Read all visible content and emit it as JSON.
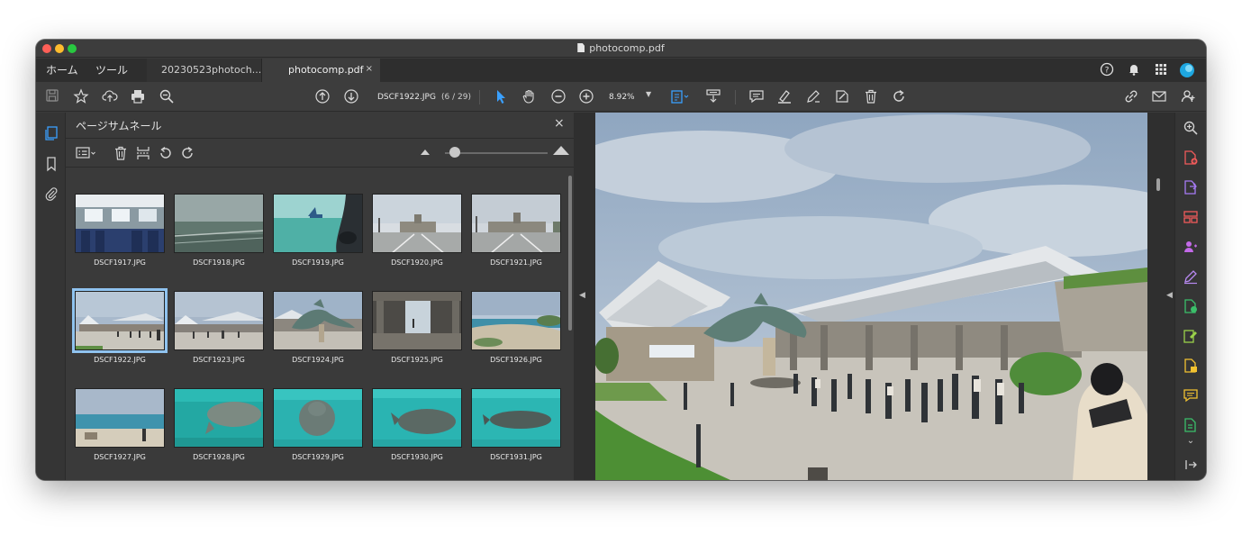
{
  "window": {
    "title": "photocomp.pdf"
  },
  "tabs": {
    "home": "ホーム",
    "tools": "ツール",
    "documents": [
      {
        "label": "20230523photoch..."
      },
      {
        "label": "photocomp.pdf",
        "close": "×"
      }
    ]
  },
  "toolbar": {
    "filename": "DSCF1922.JPG",
    "page_count": "(6 / 29)",
    "zoom": "8.92%"
  },
  "panel": {
    "title": "ページサムネール",
    "close": "×",
    "thumbnail_slider_value": 0.1,
    "thumbnails": [
      {
        "label": "DSCF1917.JPG"
      },
      {
        "label": "DSCF1918.JPG"
      },
      {
        "label": "DSCF1919.JPG"
      },
      {
        "label": "DSCF1920.JPG"
      },
      {
        "label": "DSCF1921.JPG"
      },
      {
        "label": "DSCF1922.JPG"
      },
      {
        "label": "DSCF1923.JPG"
      },
      {
        "label": "DSCF1924.JPG"
      },
      {
        "label": "DSCF1925.JPG"
      },
      {
        "label": "DSCF1926.JPG"
      },
      {
        "label": "DSCF1927.JPG"
      },
      {
        "label": "DSCF1928.JPG"
      },
      {
        "label": "DSCF1929.JPG"
      },
      {
        "label": "DSCF1930.JPG"
      },
      {
        "label": "DSCF1931.JPG"
      }
    ]
  },
  "colors": {
    "accent": "#3aa0ff",
    "selection": "#8fc3ef",
    "titlebar": "#3d3d3d",
    "panel": "#3a3a3a"
  },
  "icons": {
    "top_right": [
      "help-icon",
      "bell-icon",
      "apps-grid-icon",
      "account-avatar-icon"
    ],
    "left_rail": [
      "page-thumbnails-icon",
      "bookmark-icon",
      "attachment-icon"
    ],
    "right_rail": [
      "zoom-icon",
      "create-pdf-icon",
      "export-pdf-icon",
      "organize-pages-icon",
      "share-icon",
      "fill-sign-icon",
      "compress-pdf-icon",
      "edit-pdf-icon",
      "protect-icon",
      "comment-icon",
      "more-tools-icon",
      "collapse-panel-icon"
    ]
  }
}
